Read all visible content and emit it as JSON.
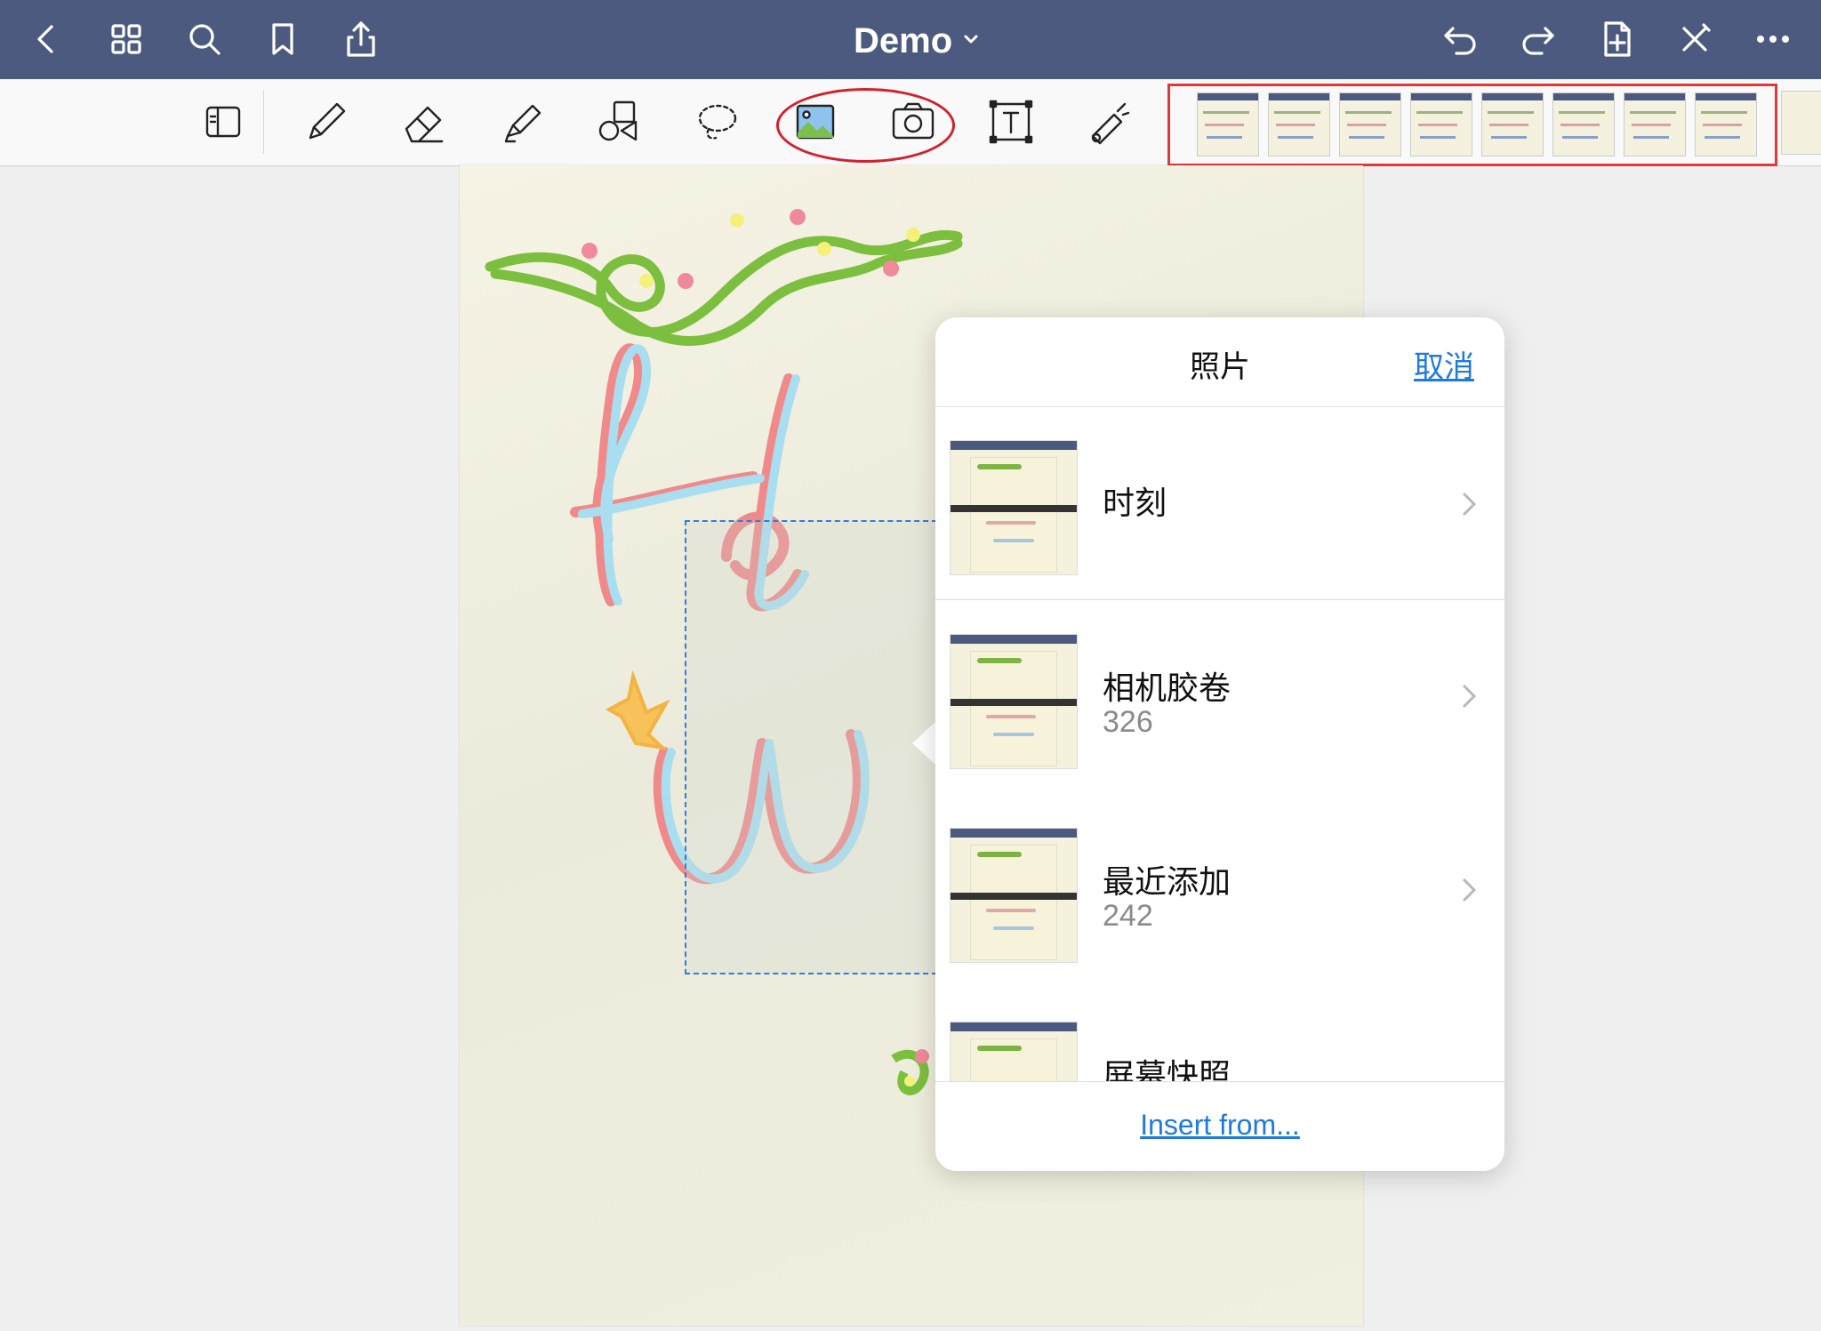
{
  "header": {
    "title": "Demo",
    "icons": [
      "back-icon",
      "grid-icon",
      "search-icon",
      "bookmark-icon",
      "share-icon",
      "chevron-down-icon",
      "undo-icon",
      "redo-icon",
      "add-page-icon",
      "close-icon",
      "more-icon"
    ]
  },
  "toolbar": {
    "tools": [
      "sidebar-toggle-icon",
      "pen-icon",
      "eraser-icon",
      "highlighter-icon",
      "shapes-icon",
      "lasso-icon",
      "image-icon",
      "camera-icon",
      "text-icon",
      "laser-pointer-icon"
    ],
    "highlight_color": "#d2202c"
  },
  "popover": {
    "title": "照片",
    "cancel": "取消",
    "albums": [
      {
        "name": "时刻",
        "count": ""
      },
      {
        "name": "相机胶卷",
        "count": "326"
      },
      {
        "name": "最近添加",
        "count": "242"
      },
      {
        "name": "屏幕快照",
        "count": ""
      }
    ],
    "insert_from": "Insert from..."
  },
  "colors": {
    "header_bg": "#4b5a7e",
    "accent": "#1f7ae0",
    "page_bg": "#f6f3e4"
  }
}
